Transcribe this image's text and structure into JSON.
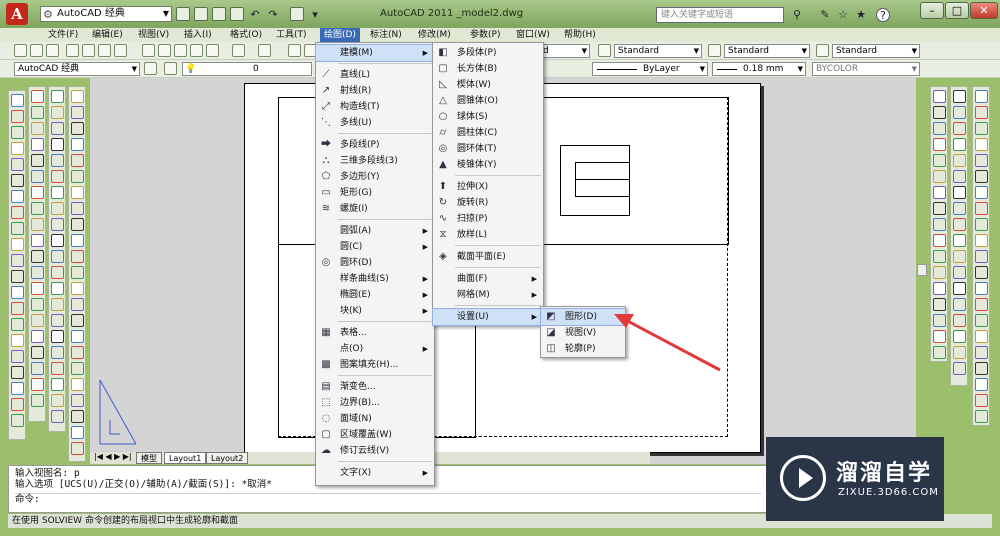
{
  "titlebar": {
    "app_logo": "A",
    "workspace": "AutoCAD 经典",
    "title": "AutoCAD 2011    _model2.dwg",
    "search_placeholder": "键入关键字或短语"
  },
  "menubar": [
    "文件(F)",
    "编辑(E)",
    "视图(V)",
    "插入(I)",
    "格式(O)",
    "工具(T)",
    "绘图(D)",
    "标注(N)",
    "修改(M)",
    "参数(P)",
    "窗口(W)",
    "帮助(H)"
  ],
  "toolbar1": {
    "text_style": "Standard",
    "dim_style": "Standard",
    "table_style": "Standard",
    "ml_style": "Standard",
    "partial": "ard"
  },
  "toolbar2": {
    "workspace": "AutoCAD 经典",
    "layer": "0",
    "color": "ByLayer",
    "linetype": "ByLayer",
    "lineweight": "0.18 mm",
    "plotstyle": "BYCOLOR"
  },
  "draw_menu": [
    {
      "label": "建模(M)",
      "arrow": true,
      "icon": "",
      "sep_before": false,
      "highlight": true
    },
    {
      "label": "直线(L)",
      "icon": "line-icon",
      "sep_before": true
    },
    {
      "label": "射线(R)",
      "icon": "ray-icon"
    },
    {
      "label": "构造线(T)",
      "icon": "xline-icon"
    },
    {
      "label": "多线(U)",
      "icon": "mline-icon"
    },
    {
      "label": "多段线(P)",
      "icon": "pline-icon",
      "sep_before": true
    },
    {
      "label": "三维多段线(3)",
      "icon": "3dpoly-icon"
    },
    {
      "label": "多边形(Y)",
      "icon": "polygon-icon"
    },
    {
      "label": "矩形(G)",
      "icon": "rectangle-icon"
    },
    {
      "label": "螺旋(I)",
      "icon": "helix-icon"
    },
    {
      "label": "圆弧(A)",
      "arrow": true,
      "sep_before": true
    },
    {
      "label": "圆(C)",
      "arrow": true
    },
    {
      "label": "圆环(D)",
      "icon": "donut-icon"
    },
    {
      "label": "样条曲线(S)",
      "arrow": true
    },
    {
      "label": "椭圆(E)",
      "arrow": true
    },
    {
      "label": "块(K)",
      "arrow": true
    },
    {
      "label": "表格...",
      "icon": "table-icon",
      "sep_before": true
    },
    {
      "label": "点(O)",
      "arrow": true
    },
    {
      "label": "图案填充(H)...",
      "icon": "hatch-icon"
    },
    {
      "label": "渐变色...",
      "icon": "gradient-icon",
      "sep_before": true
    },
    {
      "label": "边界(B)...",
      "icon": "boundary-icon"
    },
    {
      "label": "面域(N)",
      "icon": "region-icon"
    },
    {
      "label": "区域覆盖(W)",
      "icon": "wipeout-icon"
    },
    {
      "label": "修订云线(V)",
      "icon": "revcloud-icon"
    },
    {
      "label": "文字(X)",
      "arrow": true,
      "sep_before": true
    }
  ],
  "model_menu": [
    {
      "label": "多段体(P)",
      "icon": "polysolid-icon"
    },
    {
      "label": "长方体(B)",
      "icon": "box-icon"
    },
    {
      "label": "楔体(W)",
      "icon": "wedge-icon"
    },
    {
      "label": "圆锥体(O)",
      "icon": "cone-icon"
    },
    {
      "label": "球体(S)",
      "icon": "sphere-icon"
    },
    {
      "label": "圆柱体(C)",
      "icon": "cylinder-icon"
    },
    {
      "label": "圆环体(T)",
      "icon": "torus-icon"
    },
    {
      "label": "棱锥体(Y)",
      "icon": "pyramid-icon"
    },
    {
      "label": "拉伸(X)",
      "icon": "extrude-icon",
      "sep_before": true
    },
    {
      "label": "旋转(R)",
      "icon": "revolve-icon"
    },
    {
      "label": "扫掠(P)",
      "icon": "sweep-icon"
    },
    {
      "label": "放样(L)",
      "icon": "loft-icon"
    },
    {
      "label": "截面平面(E)",
      "icon": "sectionplane-icon",
      "sep_before": true
    },
    {
      "label": "曲面(F)",
      "arrow": true,
      "sep_before": true
    },
    {
      "label": "网格(M)",
      "arrow": true
    },
    {
      "label": "设置(U)",
      "arrow": true,
      "sep_before": true,
      "highlight": true
    }
  ],
  "setup_menu": [
    {
      "label": "图形(D)",
      "icon": "soldraw-icon",
      "highlight": true
    },
    {
      "label": "视图(V)",
      "icon": "solview-icon"
    },
    {
      "label": "轮廓(P)",
      "icon": "solprof-icon"
    }
  ],
  "tabs": [
    "模型",
    "Layout1",
    "Layout2"
  ],
  "command": {
    "line1": "输入视图名: p",
    "line2": "输入选项 [UCS(U)/正交(O)/辅助(A)/截面(S)]: *取消*",
    "prompt": "命令:"
  },
  "status": "在使用 SOLVIEW 命令创建的布局视口中生成轮廓和截面",
  "watermark": {
    "brand": "溜溜自学",
    "url": "ZIXUE.3D66.COM"
  },
  "colors": {
    "menu_highlight": "#cfe0f7",
    "active_menu": "#3a6ab6",
    "arrow": "#e23a3a"
  }
}
